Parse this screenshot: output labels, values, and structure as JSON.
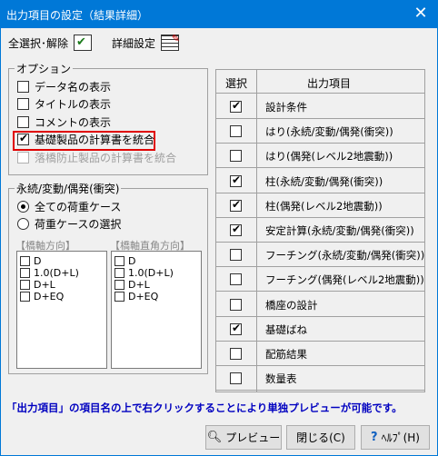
{
  "window": {
    "title": "出力項目の設定（結果詳細）",
    "close": "✕"
  },
  "toolbar": {
    "select_all": "全選択･解除",
    "detail_settings": "詳細設定"
  },
  "options": {
    "legend": "オプション",
    "items": [
      {
        "label": "データ名の表示",
        "checked": false,
        "disabled": false
      },
      {
        "label": "タイトルの表示",
        "checked": false,
        "disabled": false
      },
      {
        "label": "コメントの表示",
        "checked": false,
        "disabled": false
      },
      {
        "label": "基礎製品の計算書を統合",
        "checked": true,
        "disabled": false
      },
      {
        "label": "落橋防止製品の計算書を統合",
        "checked": false,
        "disabled": true
      }
    ]
  },
  "load_cases": {
    "legend": "永続/変動/偶発(衝突)",
    "radio_all": "全ての荷重ケース",
    "radio_select": "荷重ケースの選択",
    "bridge_axis_label": "【橋軸方向】",
    "bridge_perp_label": "【橋軸直角方向】",
    "bridge_axis": [
      "D",
      "1.0(D+L)",
      "D+L",
      "D+EQ"
    ],
    "bridge_perp": [
      "D",
      "1.0(D+L)",
      "D+L",
      "D+EQ"
    ]
  },
  "output_table": {
    "col_select": "選択",
    "col_item": "出力項目",
    "rows": [
      {
        "label": "設計条件",
        "checked": true
      },
      {
        "label": "はり(永続/変動/偶発(衝突))",
        "checked": false
      },
      {
        "label": "はり(偶発(レベル2地震動))",
        "checked": false
      },
      {
        "label": "柱(永続/変動/偶発(衝突))",
        "checked": true
      },
      {
        "label": "柱(偶発(レベル2地震動))",
        "checked": true
      },
      {
        "label": "安定計算(永続/変動/偶発(衝突))",
        "checked": true
      },
      {
        "label": "フーチング(永続/変動/偶発(衝突))",
        "checked": false
      },
      {
        "label": "フーチング(偶発(レベル2地震動))",
        "checked": false
      },
      {
        "label": "橋座の設計",
        "checked": false
      },
      {
        "label": "基礎ばね",
        "checked": true
      },
      {
        "label": "配筋結果",
        "checked": false
      },
      {
        "label": "数量表",
        "checked": false
      }
    ]
  },
  "info_text": "「出力項目」の項目名の上で右クリックすることにより単独プレビューが可能です。",
  "buttons": {
    "preview": "プレビュー",
    "close": "閉じる(C)",
    "help": "ﾍﾙﾌﾟ(H)"
  },
  "colors": {
    "title_bar": "#0078d7",
    "highlight": "#e00000",
    "info_text": "#0000c0"
  }
}
